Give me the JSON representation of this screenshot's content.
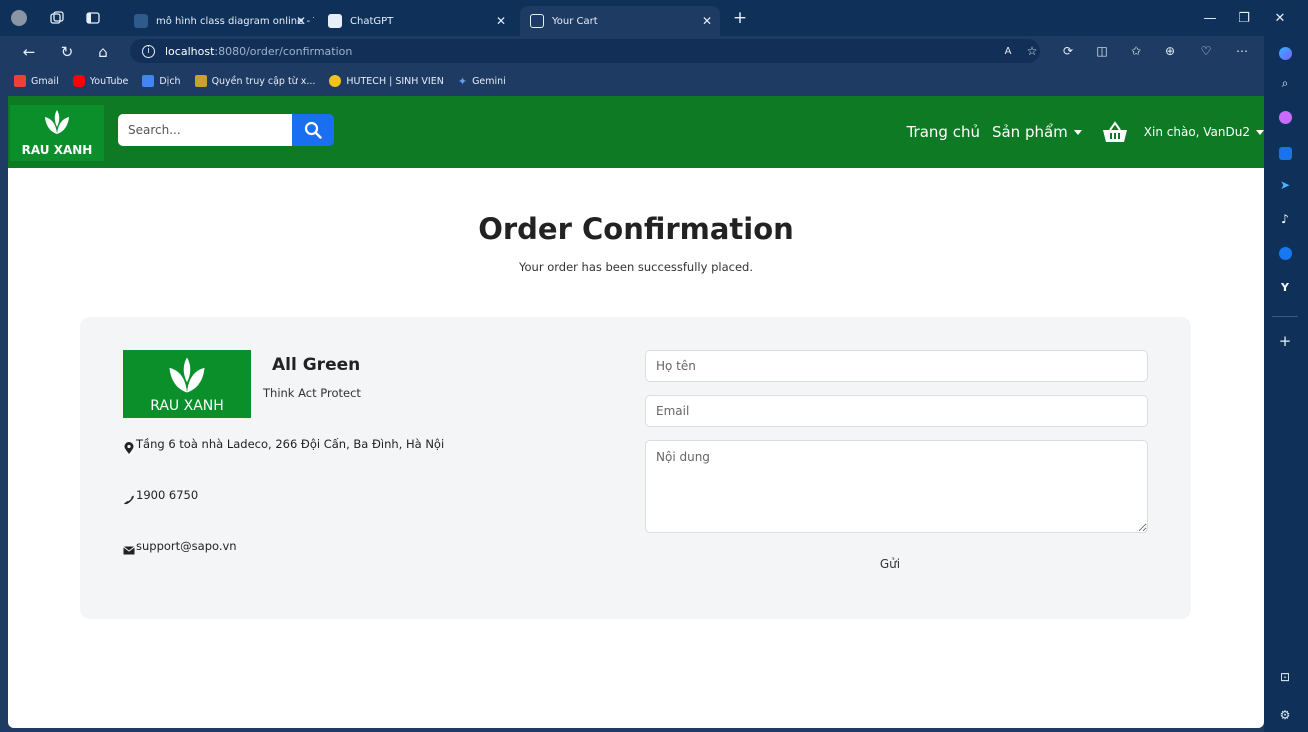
{
  "browser": {
    "tabs": [
      {
        "label": "mô hình class diagram online - T",
        "active": false
      },
      {
        "label": "ChatGPT",
        "active": false
      },
      {
        "label": "Your Cart",
        "active": true
      }
    ],
    "new_tab_glyph": "+",
    "url_host": "localhost",
    "url_path": ":8080/order/confirmation",
    "bookmarks": [
      {
        "label": "Gmail",
        "color": "#ea4335"
      },
      {
        "label": "YouTube",
        "color": "#ff0000"
      },
      {
        "label": "Dịch",
        "color": "#4285f4"
      },
      {
        "label": "Quyền truy cập từ x...",
        "color": "#c9a227"
      },
      {
        "label": "HUTECH | SINH VIEN",
        "color": "#f3c21b"
      },
      {
        "label": "Gemini",
        "color": "#6c9bff"
      }
    ]
  },
  "site": {
    "logo_text": "RAU XANH",
    "search_placeholder": "Search...",
    "nav": {
      "home": "Trang chủ",
      "products": "Sản phẩm",
      "greeting": "Xin chào, VanDu2"
    }
  },
  "confirmation": {
    "title": "Order Confirmation",
    "subtitle": "Your order has been successfully placed."
  },
  "contact": {
    "logo_text": "RAU XANH",
    "brand_name": "All Green",
    "tagline": "Think Act Protect",
    "address": "Tầng 6 toà nhà Ladeco, 266 Đội Cấn, Ba Đình, Hà Nội",
    "phone": "1900 6750",
    "email": "support@sapo.vn"
  },
  "form": {
    "name_placeholder": "Họ tên",
    "email_placeholder": "Email",
    "message_placeholder": "Nội dung",
    "submit_label": "Gửi"
  },
  "colors": {
    "navbar": "#0f7a24",
    "logo_bg": "#0a8f2a",
    "search_button": "#1a6ff0",
    "card_bg": "#f4f5f7",
    "browser_frame": "#0f3159"
  }
}
